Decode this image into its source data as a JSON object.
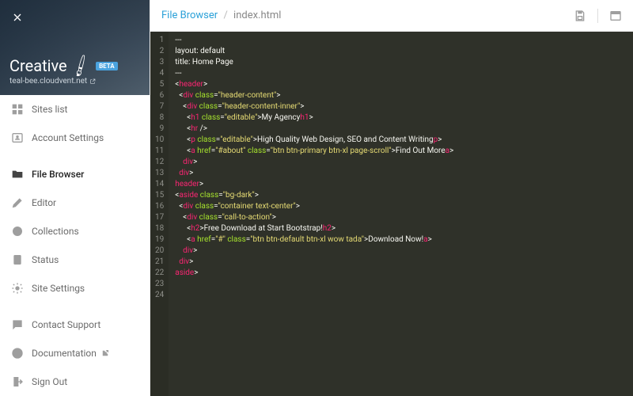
{
  "hero": {
    "title": "Creative",
    "pencil": "🖌",
    "badge": "BETA",
    "domain": "teal-bee.cloudvent.net"
  },
  "nav": {
    "sites_list": "Sites list",
    "account_settings": "Account Settings",
    "file_browser": "File Browser",
    "editor": "Editor",
    "collections": "Collections",
    "status": "Status",
    "site_settings": "Site Settings",
    "contact_support": "Contact Support",
    "documentation": "Documentation",
    "sign_out": "Sign Out"
  },
  "breadcrumb": {
    "first": "File Browser",
    "sep": "/",
    "second": "index.html"
  },
  "gutter": [
    "1",
    "2",
    "3",
    "4",
    "5",
    "6",
    "7",
    "8",
    "9",
    "10",
    "11",
    "12",
    "13",
    "14",
    "15",
    "16",
    "17",
    "18",
    "19",
    "20",
    "21",
    "22",
    "23",
    "24"
  ],
  "code": {
    "l1": "---",
    "l2": "layout: default",
    "l3": "title: Home Page",
    "l4": "---",
    "l5": "",
    "l6_open": "<",
    "l6_tag": "header",
    "l6_close": ">",
    "l7_o": "<",
    "l7_tag": "div",
    "l7_attr": " class",
    "l7_eq": "=",
    "l7_val": "\"header-content\"",
    "l7_c": ">",
    "l8_o": "<",
    "l8_tag": "div",
    "l8_attr": " class",
    "l8_eq": "=",
    "l8_val": "\"header-content-inner\"",
    "l8_c": ">",
    "l9_o": "<",
    "l9_tag": "h1",
    "l9_attr": " class",
    "l9_eq": "=",
    "l9_val": "\"editable\"",
    "l9_c": ">",
    "l9_txt": "My Agency",
    "l9_co": "</",
    "l9_ct": "h1",
    "l9_cc": ">",
    "l10_o": "<",
    "l10_tag": "hr",
    "l10_c": " />",
    "l11_o": "<",
    "l11_tag": "p",
    "l11_attr": " class",
    "l11_eq": "=",
    "l11_val": "\"editable\"",
    "l11_c": ">",
    "l11_txt": "High Quality Web Design, SEO and Content Writing",
    "l11_co": "</",
    "l11_ct": "p",
    "l11_cc": ">",
    "l12_o": "<",
    "l12_tag": "a",
    "l12_attr1": " href",
    "l12_eq1": "=",
    "l12_val1": "\"#about\"",
    "l12_attr2": " class",
    "l12_eq2": "=",
    "l12_val2": "\"btn btn-primary btn-xl page-scroll\"",
    "l12_c": ">",
    "l12_txt": "Find Out More",
    "l12_co": "</",
    "l12_ct": "a",
    "l12_cc": ">",
    "l13_o": "</",
    "l13_tag": "div",
    "l13_c": ">",
    "l14_o": "</",
    "l14_tag": "div",
    "l14_c": ">",
    "l15_o": "</",
    "l15_tag": "header",
    "l15_c": ">",
    "l16": "",
    "l17_o": "<",
    "l17_tag": "aside",
    "l17_attr": " class",
    "l17_eq": "=",
    "l17_val": "\"bg-dark\"",
    "l17_c": ">",
    "l18_o": "<",
    "l18_tag": "div",
    "l18_attr": " class",
    "l18_eq": "=",
    "l18_val": "\"container text-center\"",
    "l18_c": ">",
    "l19_o": "<",
    "l19_tag": "div",
    "l19_attr": " class",
    "l19_eq": "=",
    "l19_val": "\"call-to-action\"",
    "l19_c": ">",
    "l20_o": "<",
    "l20_tag": "h2",
    "l20_c": ">",
    "l20_txt": "Free Download at Start Bootstrap!",
    "l20_co": "</",
    "l20_ct": "h2",
    "l20_cc": ">",
    "l21_o": "<",
    "l21_tag": "a",
    "l21_attr1": " href",
    "l21_eq1": "=",
    "l21_val1": "\"#\"",
    "l21_attr2": " class",
    "l21_eq2": "=",
    "l21_val2": "\"btn btn-default btn-xl wow tada\"",
    "l21_c": ">",
    "l21_txt": "Download Now!",
    "l21_co": "</",
    "l21_ct": "a",
    "l21_cc": ">",
    "l22_o": "</",
    "l22_tag": "div",
    "l22_c": ">",
    "l23_o": "</",
    "l23_tag": "div",
    "l23_c": ">",
    "l24_o": "</",
    "l24_tag": "aside",
    "l24_c": ">"
  }
}
